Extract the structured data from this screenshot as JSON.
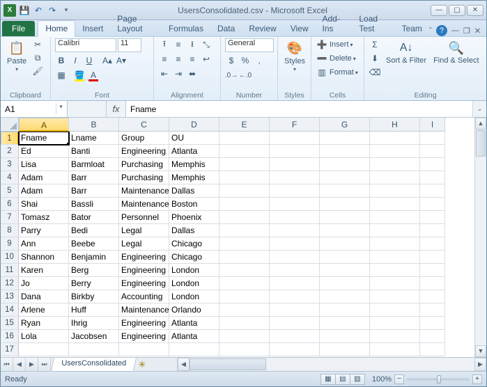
{
  "window": {
    "title": "UsersConsolidated.csv - Microsoft Excel",
    "app_abbrev": "X"
  },
  "ribbon": {
    "file_label": "File",
    "tabs": [
      "Home",
      "Insert",
      "Page Layout",
      "Formulas",
      "Data",
      "Review",
      "View",
      "Add-Ins",
      "Load Test",
      "Team"
    ],
    "active_tab": "Home",
    "groups": {
      "clipboard": "Clipboard",
      "font": "Font",
      "alignment": "Alignment",
      "number": "Number",
      "styles": "Styles",
      "cells": "Cells",
      "editing": "Editing"
    },
    "paste": "Paste",
    "font_name": "Calibri",
    "font_size": "11",
    "number_format": "General",
    "styles_btn": "Styles",
    "insert": "Insert",
    "delete": "Delete",
    "format": "Format",
    "sort_filter": "Sort & Filter",
    "find_select": "Find & Select"
  },
  "formula_bar": {
    "name_box": "A1",
    "fx": "fx",
    "formula": "Fname"
  },
  "grid": {
    "columns": [
      "A",
      "B",
      "C",
      "D",
      "E",
      "F",
      "G",
      "H",
      "I"
    ],
    "selected_col": "A",
    "selected_row": 1,
    "row_start": 1,
    "row_count": 17,
    "data": [
      [
        "Fname",
        "Lname",
        "Group",
        "OU"
      ],
      [
        "Ed",
        "Banti",
        "Engineering",
        "Atlanta"
      ],
      [
        "Lisa",
        "Barmloat",
        "Purchasing",
        "Memphis"
      ],
      [
        "Adam",
        "Barr",
        "Purchasing",
        "Memphis"
      ],
      [
        "Adam",
        "Barr",
        "Maintenance",
        "Dallas"
      ],
      [
        "Shai",
        "Bassli",
        "Maintenance",
        "Boston"
      ],
      [
        "Tomasz",
        "Bator",
        "Personnel",
        "Phoenix"
      ],
      [
        "Parry",
        "Bedi",
        "Legal",
        "Dallas"
      ],
      [
        "Ann",
        "Beebe",
        "Legal",
        "Chicago"
      ],
      [
        "Shannon",
        "Benjamin",
        "Engineering",
        "Chicago"
      ],
      [
        "Karen",
        "Berg",
        "Engineering",
        "London"
      ],
      [
        "Jo",
        "Berry",
        "Engineering",
        "London"
      ],
      [
        "Dana",
        "Birkby",
        "Accounting",
        "London"
      ],
      [
        "Arlene",
        "Huff",
        "Maintenance",
        "Orlando"
      ],
      [
        "Ryan",
        "Ihrig",
        "Engineering",
        "Atlanta"
      ],
      [
        "Lola",
        "Jacobsen",
        "Engineering",
        "Atlanta"
      ],
      [
        "",
        "",
        "",
        ""
      ]
    ]
  },
  "sheet": {
    "active": "UsersConsolidated"
  },
  "status": {
    "ready": "Ready",
    "zoom": "100%"
  }
}
